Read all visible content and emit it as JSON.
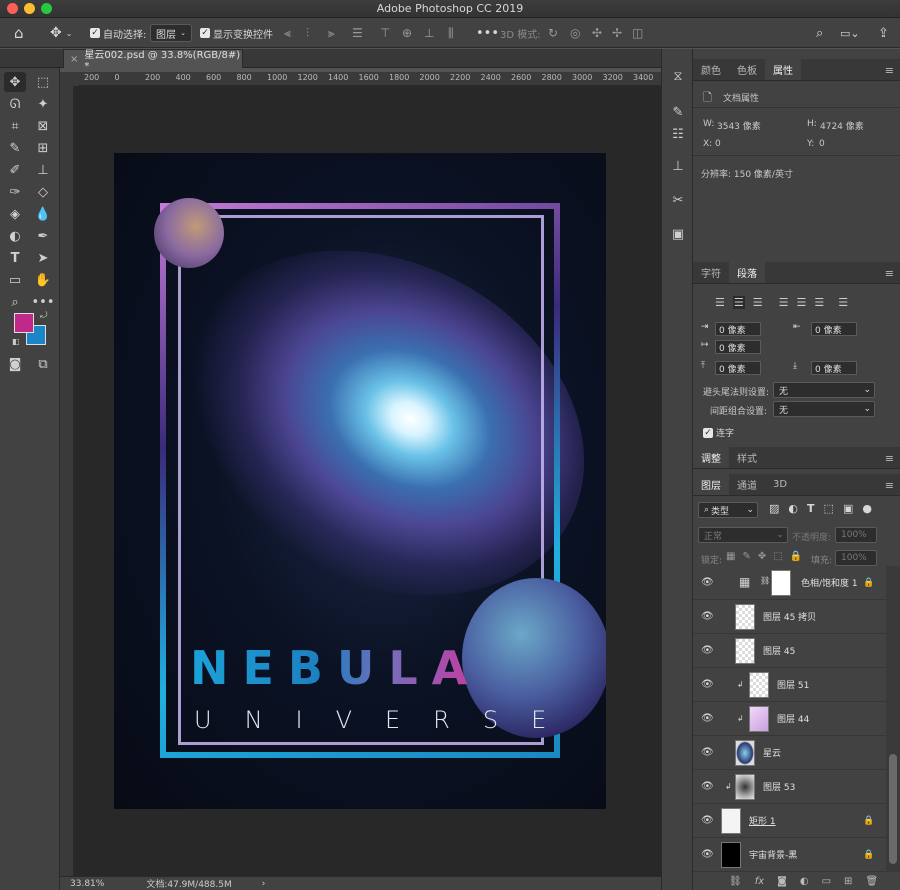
{
  "app": {
    "title": "Adobe Photoshop CC 2019"
  },
  "options_bar": {
    "auto_select_label": "自动选择:",
    "auto_select_value": "图层",
    "show_transform_label": "显示变换控件",
    "mode_3d_label": "3D 模式:"
  },
  "document": {
    "tab_title": "星云002.psd @ 33.8%(RGB/8#) *",
    "zoom": "33.81%",
    "doc_info": "文档:47.9M/488.5M",
    "ruler_ticks": [
      "200",
      "0",
      "200",
      "400",
      "600",
      "800",
      "1000",
      "1200",
      "1400",
      "1600",
      "1800",
      "2000",
      "2200",
      "2400",
      "2600",
      "2800",
      "3000",
      "3200",
      "3400",
      "3600"
    ],
    "poster": {
      "title": "NEBULA",
      "subtitle": "UNIVERSE"
    }
  },
  "panels": {
    "top_tabs": [
      "颜色",
      "色板",
      "属性"
    ],
    "properties": {
      "header": "文档属性",
      "w_label": "W:",
      "w_value": "3543 像素",
      "h_label": "H:",
      "h_value": "4724 像素",
      "x_label": "X:",
      "x_value": "0",
      "y_label": "Y:",
      "y_value": "0",
      "resolution": "分辨率: 150 像素/英寸"
    },
    "para_tabs": [
      "字符",
      "段落"
    ],
    "paragraph": {
      "indent_left": "0 像素",
      "indent_right": "0 像素",
      "indent_first": "0 像素",
      "space_before": "0 像素",
      "space_after": "0 像素",
      "kinsoku_label": "避头尾法则设置:",
      "kinsoku_value": "无",
      "mojikumi_label": "间距组合设置:",
      "mojikumi_value": "无",
      "hyphenate_label": "连字"
    },
    "adj_tabs": [
      "调整",
      "样式"
    ],
    "layer_tabs": [
      "图层",
      "通道",
      "3D"
    ],
    "layers": {
      "filter_kind": "类型",
      "blend_mode": "正常",
      "opacity_label": "不透明度:",
      "opacity_value": "100%",
      "lock_label": "锁定:",
      "fill_label": "填充:",
      "fill_value": "100%",
      "items": [
        {
          "name": "色相/饱和度 1"
        },
        {
          "name": "图层 45 拷贝"
        },
        {
          "name": "图层 45"
        },
        {
          "name": "图层 51"
        },
        {
          "name": "图层 44"
        },
        {
          "name": "星云"
        },
        {
          "name": "图层 53"
        },
        {
          "name": "矩形 1"
        },
        {
          "name": "宇宙背景-黑"
        }
      ]
    }
  },
  "colors": {
    "foreground": "#c0298a",
    "background": "#1a86c7"
  }
}
